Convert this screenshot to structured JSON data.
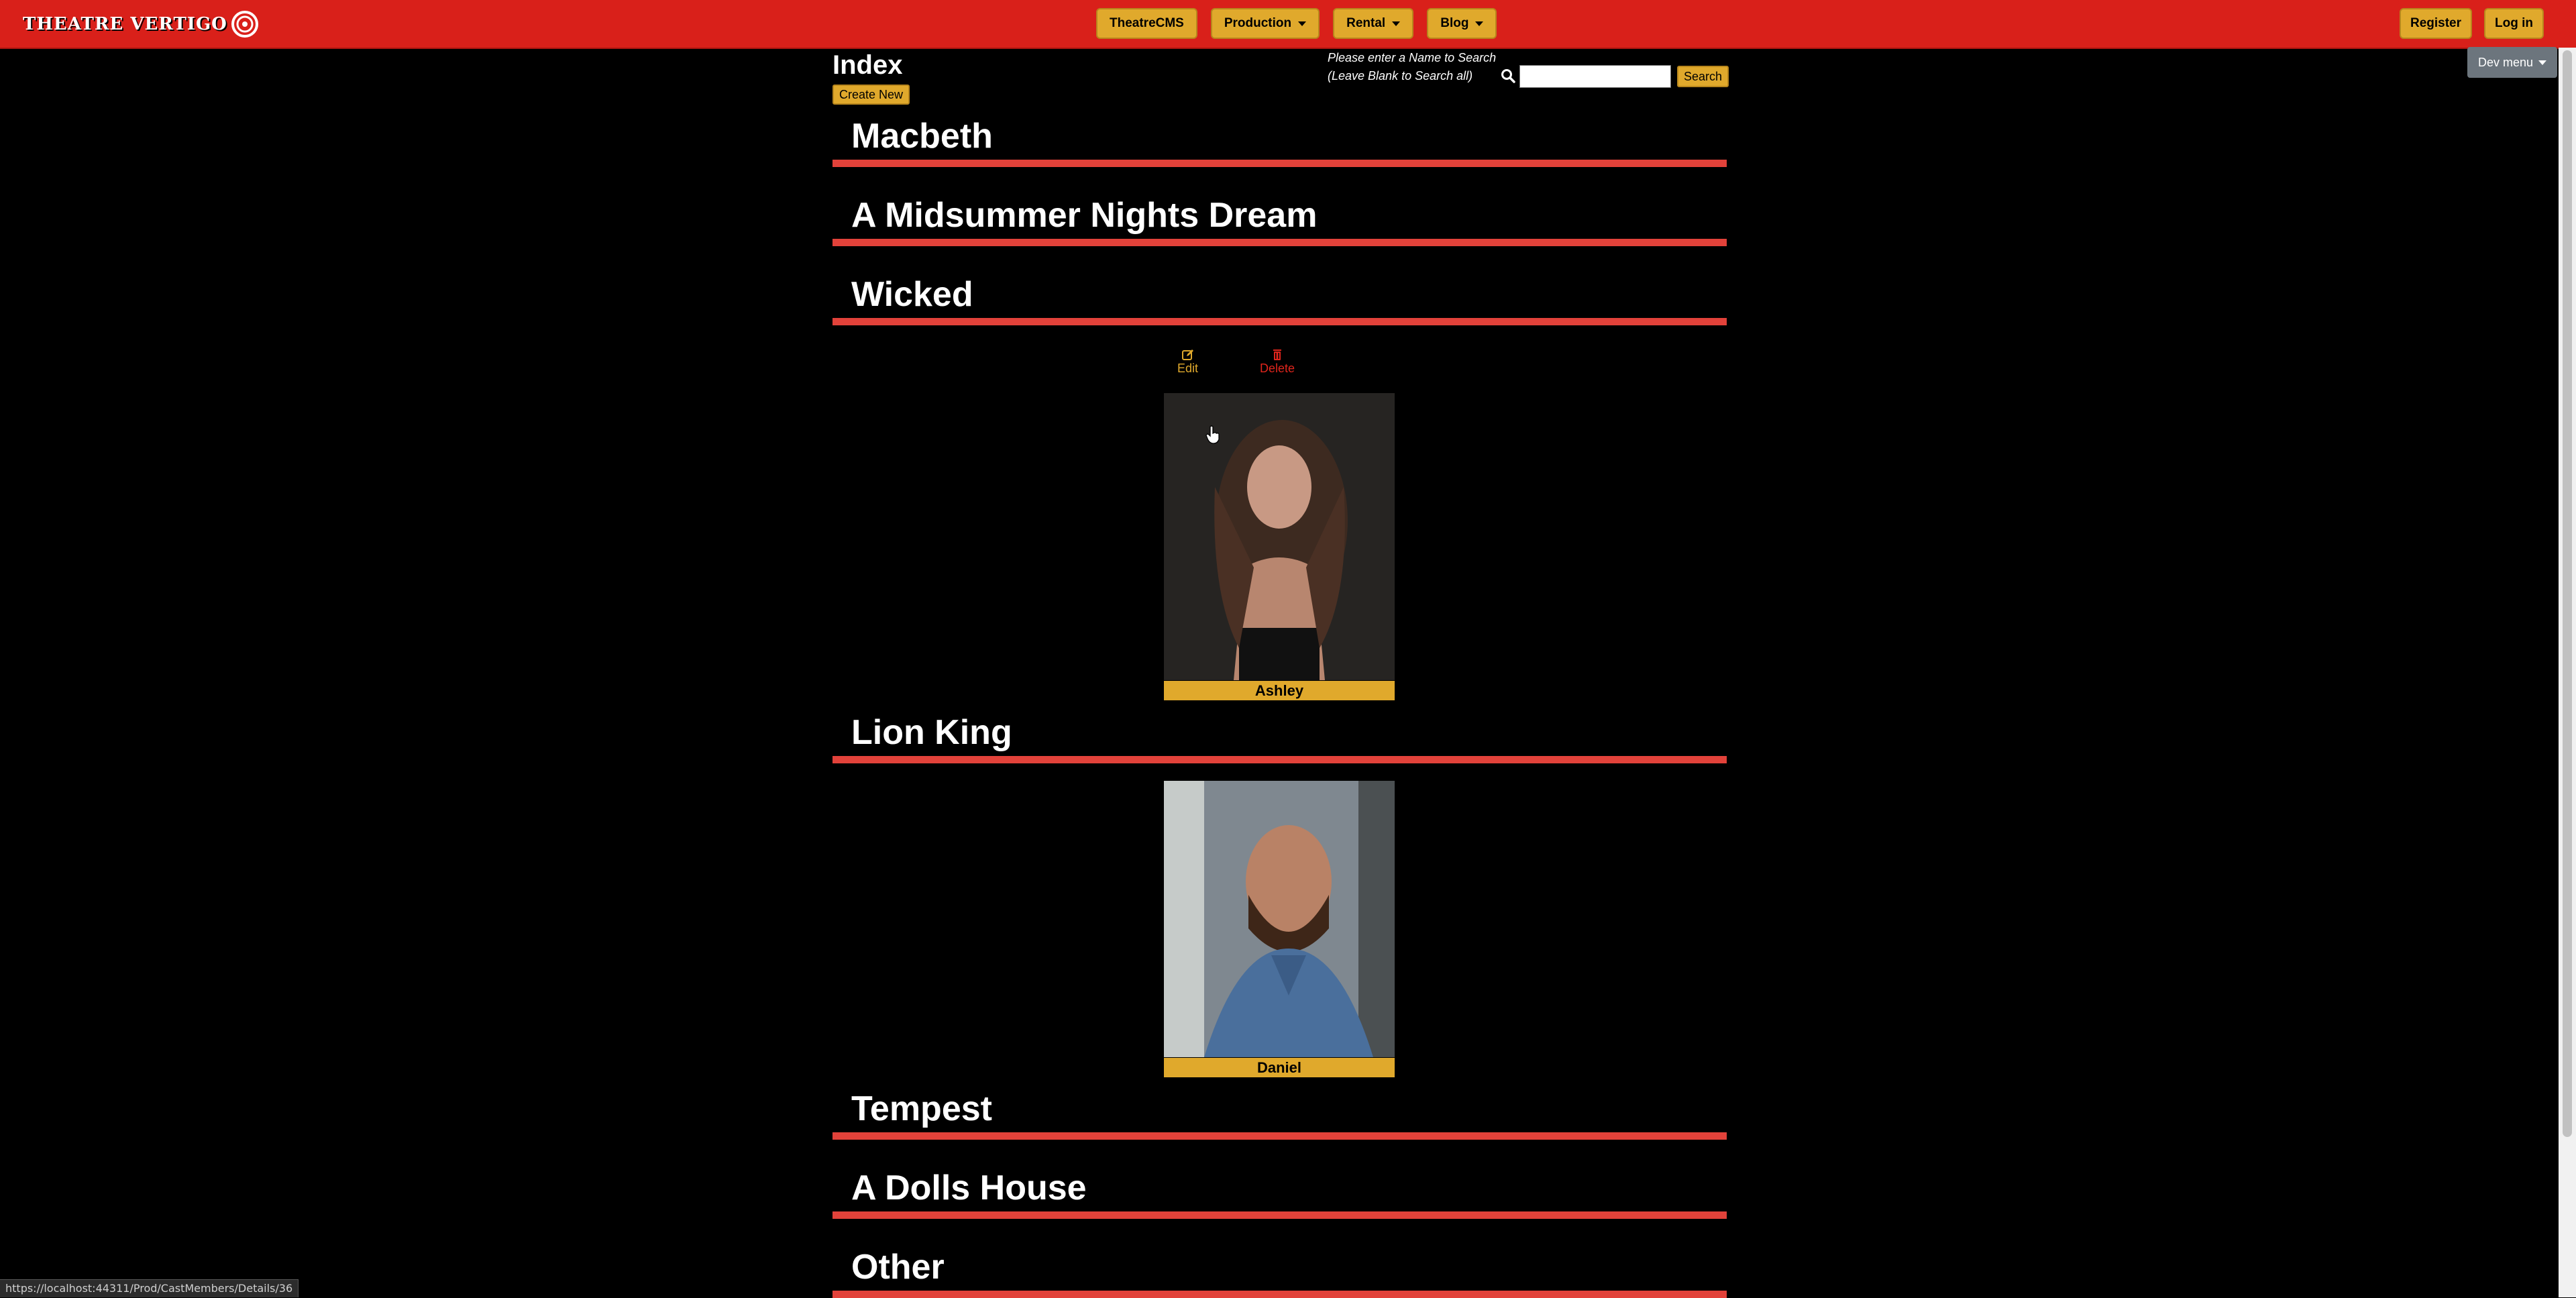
{
  "navbar": {
    "brand": "THEATRE VERTIGO",
    "items": [
      {
        "label": "TheatreCMS",
        "dropdown": false
      },
      {
        "label": "Production",
        "dropdown": true
      },
      {
        "label": "Rental",
        "dropdown": true
      },
      {
        "label": "Blog",
        "dropdown": true
      }
    ],
    "register_label": "Register",
    "login_label": "Log in",
    "dev_menu_label": "Dev menu"
  },
  "page": {
    "title": "Index",
    "create_label": "Create New",
    "search_hint_line1": "Please enter a Name to Search",
    "search_hint_line2": "(Leave Blank to Search all)",
    "search_value": "",
    "search_button": "Search"
  },
  "productions": [
    {
      "title": "Macbeth"
    },
    {
      "title": "A Midsummer Nights Dream"
    },
    {
      "title": "Wicked"
    },
    {
      "title": "Lion King"
    },
    {
      "title": "Tempest"
    },
    {
      "title": "A Dolls House"
    },
    {
      "title": "Other"
    }
  ],
  "cast": [
    {
      "name": "Ashley",
      "production": "Wicked",
      "edit_label": "Edit",
      "delete_label": "Delete"
    },
    {
      "name": "Daniel",
      "production": "Lion King"
    }
  ],
  "status_bar_url": "https://localhost:44311/Prod/CastMembers/Details/36",
  "colors": {
    "navbar": "#d9201a",
    "accent": "#e0a92c",
    "divider": "#e2423a",
    "background": "#000000"
  }
}
